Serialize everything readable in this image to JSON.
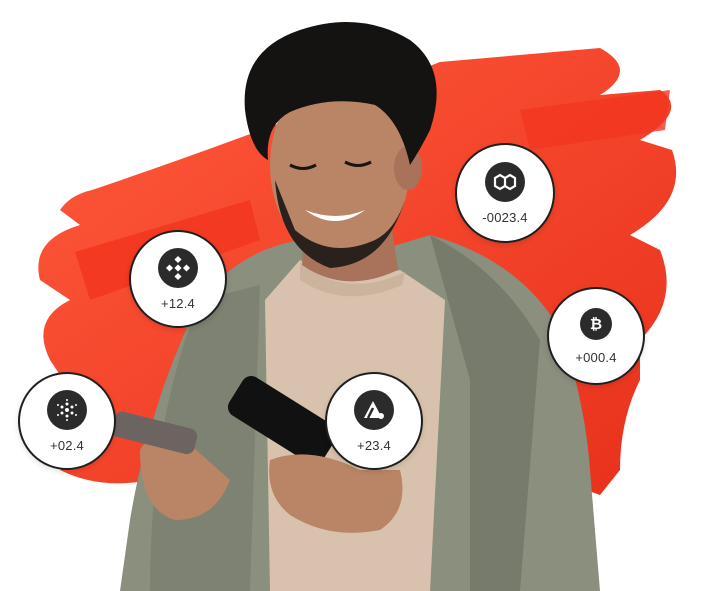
{
  "colors": {
    "brush": "#f2361f",
    "brush_light": "#ff5a3c",
    "badge_border": "#1f1f1f",
    "coin_bg": "#2b2b2b",
    "jacket": "#8a8f7e",
    "sweater": "#d9c2ad",
    "skin": "#b98566",
    "hair": "#151311"
  },
  "badges": {
    "bnb": {
      "icon": "bnb-icon",
      "value": "+12.4"
    },
    "polygon": {
      "icon": "polygon-icon",
      "value": "-0023.4"
    },
    "bitcoin": {
      "icon": "bitcoin-icon",
      "value": "+000.4"
    },
    "cardano": {
      "icon": "cardano-icon",
      "value": "+02.4"
    },
    "avax": {
      "icon": "avalanche-icon",
      "value": "+23.4"
    }
  }
}
